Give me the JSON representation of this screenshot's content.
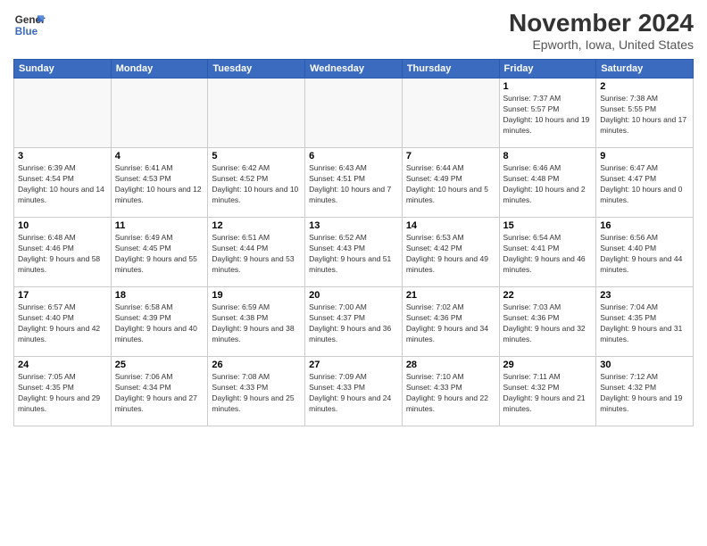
{
  "logo": {
    "line1": "General",
    "line2": "Blue"
  },
  "title": "November 2024",
  "subtitle": "Epworth, Iowa, United States",
  "headers": [
    "Sunday",
    "Monday",
    "Tuesday",
    "Wednesday",
    "Thursday",
    "Friday",
    "Saturday"
  ],
  "weeks": [
    [
      {
        "day": "",
        "info": ""
      },
      {
        "day": "",
        "info": ""
      },
      {
        "day": "",
        "info": ""
      },
      {
        "day": "",
        "info": ""
      },
      {
        "day": "",
        "info": ""
      },
      {
        "day": "1",
        "info": "Sunrise: 7:37 AM\nSunset: 5:57 PM\nDaylight: 10 hours and 19 minutes."
      },
      {
        "day": "2",
        "info": "Sunrise: 7:38 AM\nSunset: 5:55 PM\nDaylight: 10 hours and 17 minutes."
      }
    ],
    [
      {
        "day": "3",
        "info": "Sunrise: 6:39 AM\nSunset: 4:54 PM\nDaylight: 10 hours and 14 minutes."
      },
      {
        "day": "4",
        "info": "Sunrise: 6:41 AM\nSunset: 4:53 PM\nDaylight: 10 hours and 12 minutes."
      },
      {
        "day": "5",
        "info": "Sunrise: 6:42 AM\nSunset: 4:52 PM\nDaylight: 10 hours and 10 minutes."
      },
      {
        "day": "6",
        "info": "Sunrise: 6:43 AM\nSunset: 4:51 PM\nDaylight: 10 hours and 7 minutes."
      },
      {
        "day": "7",
        "info": "Sunrise: 6:44 AM\nSunset: 4:49 PM\nDaylight: 10 hours and 5 minutes."
      },
      {
        "day": "8",
        "info": "Sunrise: 6:46 AM\nSunset: 4:48 PM\nDaylight: 10 hours and 2 minutes."
      },
      {
        "day": "9",
        "info": "Sunrise: 6:47 AM\nSunset: 4:47 PM\nDaylight: 10 hours and 0 minutes."
      }
    ],
    [
      {
        "day": "10",
        "info": "Sunrise: 6:48 AM\nSunset: 4:46 PM\nDaylight: 9 hours and 58 minutes."
      },
      {
        "day": "11",
        "info": "Sunrise: 6:49 AM\nSunset: 4:45 PM\nDaylight: 9 hours and 55 minutes."
      },
      {
        "day": "12",
        "info": "Sunrise: 6:51 AM\nSunset: 4:44 PM\nDaylight: 9 hours and 53 minutes."
      },
      {
        "day": "13",
        "info": "Sunrise: 6:52 AM\nSunset: 4:43 PM\nDaylight: 9 hours and 51 minutes."
      },
      {
        "day": "14",
        "info": "Sunrise: 6:53 AM\nSunset: 4:42 PM\nDaylight: 9 hours and 49 minutes."
      },
      {
        "day": "15",
        "info": "Sunrise: 6:54 AM\nSunset: 4:41 PM\nDaylight: 9 hours and 46 minutes."
      },
      {
        "day": "16",
        "info": "Sunrise: 6:56 AM\nSunset: 4:40 PM\nDaylight: 9 hours and 44 minutes."
      }
    ],
    [
      {
        "day": "17",
        "info": "Sunrise: 6:57 AM\nSunset: 4:40 PM\nDaylight: 9 hours and 42 minutes."
      },
      {
        "day": "18",
        "info": "Sunrise: 6:58 AM\nSunset: 4:39 PM\nDaylight: 9 hours and 40 minutes."
      },
      {
        "day": "19",
        "info": "Sunrise: 6:59 AM\nSunset: 4:38 PM\nDaylight: 9 hours and 38 minutes."
      },
      {
        "day": "20",
        "info": "Sunrise: 7:00 AM\nSunset: 4:37 PM\nDaylight: 9 hours and 36 minutes."
      },
      {
        "day": "21",
        "info": "Sunrise: 7:02 AM\nSunset: 4:36 PM\nDaylight: 9 hours and 34 minutes."
      },
      {
        "day": "22",
        "info": "Sunrise: 7:03 AM\nSunset: 4:36 PM\nDaylight: 9 hours and 32 minutes."
      },
      {
        "day": "23",
        "info": "Sunrise: 7:04 AM\nSunset: 4:35 PM\nDaylight: 9 hours and 31 minutes."
      }
    ],
    [
      {
        "day": "24",
        "info": "Sunrise: 7:05 AM\nSunset: 4:35 PM\nDaylight: 9 hours and 29 minutes."
      },
      {
        "day": "25",
        "info": "Sunrise: 7:06 AM\nSunset: 4:34 PM\nDaylight: 9 hours and 27 minutes."
      },
      {
        "day": "26",
        "info": "Sunrise: 7:08 AM\nSunset: 4:33 PM\nDaylight: 9 hours and 25 minutes."
      },
      {
        "day": "27",
        "info": "Sunrise: 7:09 AM\nSunset: 4:33 PM\nDaylight: 9 hours and 24 minutes."
      },
      {
        "day": "28",
        "info": "Sunrise: 7:10 AM\nSunset: 4:33 PM\nDaylight: 9 hours and 22 minutes."
      },
      {
        "day": "29",
        "info": "Sunrise: 7:11 AM\nSunset: 4:32 PM\nDaylight: 9 hours and 21 minutes."
      },
      {
        "day": "30",
        "info": "Sunrise: 7:12 AM\nSunset: 4:32 PM\nDaylight: 9 hours and 19 minutes."
      }
    ]
  ]
}
